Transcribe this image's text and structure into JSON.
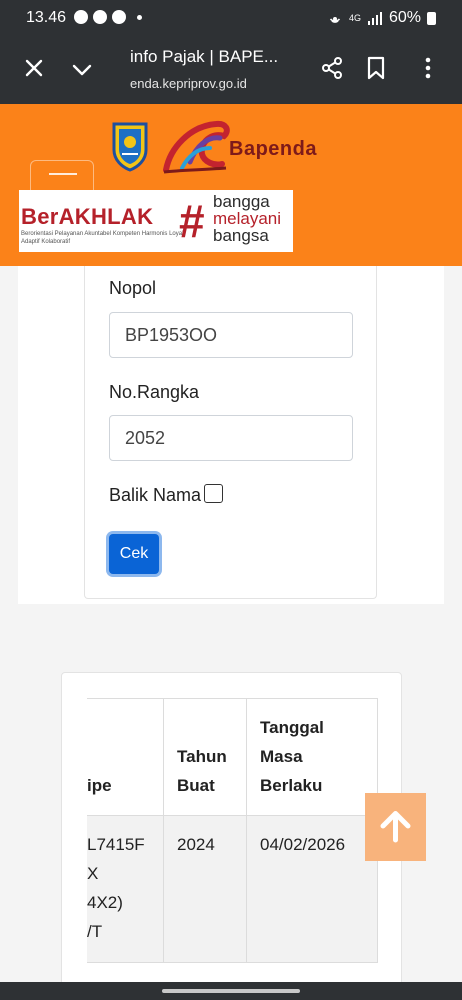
{
  "status_bar": {
    "time": "13.46",
    "network": "4G",
    "battery": "60%"
  },
  "browser": {
    "title": "info Pajak | BAPE...",
    "url": "enda.kepriprov.go.id"
  },
  "header": {
    "brand": "Bapenda",
    "banner": {
      "title": "BerAKHLAK",
      "subtitle": "Berorientasi Pelayanan Akuntabel Kompeten Harmonis Loyal Adaptif Kolaboratif",
      "hash": "#",
      "tagline_1": "bangga",
      "tagline_2": "melayani",
      "tagline_3": "bangsa"
    }
  },
  "form": {
    "nopol_label": "Nopol",
    "nopol_value": "BP1953OO",
    "rangka_label": "No.Rangka",
    "rangka_value": "2052",
    "balik_label": "Balik Nama",
    "submit_label": "Cek"
  },
  "result_table": {
    "headers": {
      "tipe": "ipe",
      "tahun_1": "Tahun",
      "tahun_2": "Buat",
      "masa_1": "Tanggal",
      "masa_2": "Masa",
      "masa_3": "Berlaku"
    },
    "row": {
      "tipe_1": "L7415F",
      "tipe_2": "X",
      "tipe_3": "4X2)",
      "tipe_4": "/T",
      "tahun": "2024",
      "masa": "04/02/2026"
    }
  },
  "colors": {
    "header_bg": "#fb8219",
    "button_bg": "#0a64d6",
    "chrome_bg": "#2e3134"
  }
}
